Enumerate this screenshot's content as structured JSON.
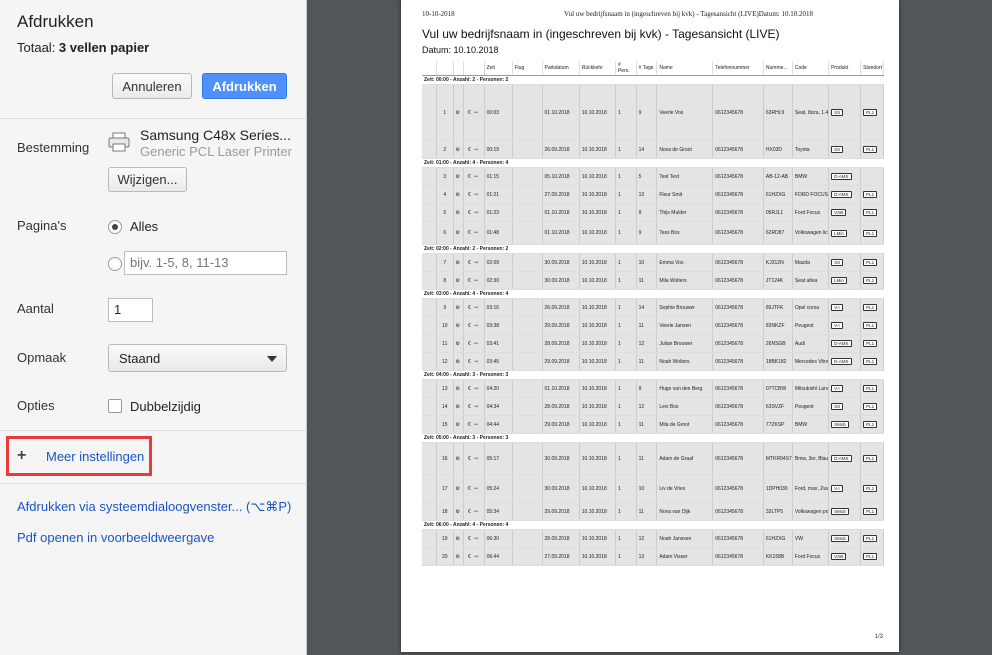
{
  "dialog": {
    "title": "Afdrukken",
    "total_prefix": "Totaal: ",
    "total_value": "3 vellen papier",
    "cancel_label": "Annuleren",
    "print_label": "Afdrukken",
    "destination_label": "Bestemming",
    "printer_name": "Samsung C48x Series...",
    "printer_driver": "Generic PCL Laser Printer",
    "change_label": "Wijzigen...",
    "pages_label": "Pagina's",
    "pages_all": "Alles",
    "pages_range_placeholder": "bijv. 1-5, 8, 11-13",
    "copies_label": "Aantal",
    "copies_value": "1",
    "layout_label": "Opmaak",
    "layout_value": "Staand",
    "options_label": "Opties",
    "duplex_label": "Dubbelzijdig",
    "more_settings": "Meer instellingen",
    "system_dialog_link": "Afdrukken via systeemdialoogvenster... (⌥⌘P)",
    "open_pdf_link": "Pdf openen in voorbeeldweergave"
  },
  "preview": {
    "header_date": "10-10-2018",
    "header_title": "Vul uw bedrijfsnaam in (ingeschreven bij kvk) - Tagesansicht (LIVE)Datum: 10.10.2018",
    "title": "Vul uw bedrijfsnaam in (ingeschreven bij kvk) - Tagesansicht (LIVE)",
    "date_line": "Datum: 10.10.2018",
    "page_number": "1/3",
    "columns": [
      "",
      "",
      "",
      "",
      "Zeit",
      "Flug",
      "Parkdatum",
      "Rückkehr",
      "# Pers.",
      "# Tage",
      "Name",
      "Telefonnummer",
      "Numme...",
      "Code",
      "Produkt",
      "Standort"
    ],
    "groups": [
      {
        "label": "Zeit: 00:00 - Anzahl: 2 - Personen: 2",
        "rows": [
          {
            "n": "1",
            "time": "00:03",
            "park": "01.10.2018",
            "ret": "10.10.2018",
            "pers": "1",
            "days": "9",
            "name": "Veerle Vos",
            "phone": "0612345678",
            "num": "63RHL9",
            "code": "Seat, Ibiza, 1.4 16V, Zwart",
            "prod": "SS",
            "loc": "PL1"
          },
          {
            "n": "2",
            "time": "00:19",
            "park": "26.09.2018",
            "ret": "10.10.2018",
            "pers": "1",
            "days": "14",
            "name": "Nova de Groot",
            "phone": "0612345678",
            "num": "HX03D",
            "code": "Toyota",
            "prod": "SS",
            "loc": "PL1"
          }
        ]
      },
      {
        "label": "Zeit: 01:00 - Anzahl: 4 - Personen: 4",
        "rows": [
          {
            "n": "3",
            "time": "01:15",
            "park": "05.10.2018",
            "ret": "10.10.2018",
            "pers": "1",
            "days": "5",
            "name": "Test Test",
            "phone": "0612345678",
            "num": "AB-12-AB",
            "code": "BMW",
            "prod": "D-AMS",
            "loc": ""
          },
          {
            "n": "4",
            "time": "01:21",
            "park": "27.09.2018",
            "ret": "10.10.2018",
            "pers": "1",
            "days": "13",
            "name": "Fleur Smit",
            "phone": "0612345678",
            "num": "61HZXG",
            "code": "FORD FOCUS",
            "prod": "D-AMS",
            "loc": "PL1"
          },
          {
            "n": "5",
            "time": "01:23",
            "park": "01.10.2018",
            "ret": "10.10.2018",
            "pers": "1",
            "days": "9",
            "name": "Thijs Mulder",
            "phone": "0612345678",
            "num": "05RJL1",
            "code": "Ford Focus",
            "prod": "VSB",
            "loc": "PL1"
          },
          {
            "n": "6",
            "time": "01:48",
            "park": "01.10.2018",
            "ret": "10.10.2018",
            "pers": "1",
            "days": "9",
            "name": "Tess Bos",
            "phone": "0612345678",
            "num": "62RD87",
            "code": "Volkswagen lichtblauw",
            "prod": "LMin",
            "loc": "PL1"
          }
        ]
      },
      {
        "label": "Zeit: 02:00 - Anzahl: 2 - Personen: 2",
        "rows": [
          {
            "n": "7",
            "time": "02:09",
            "park": "30.09.2018",
            "ret": "10.10.2018",
            "pers": "1",
            "days": "10",
            "name": "Emma Vos",
            "phone": "0612345678",
            "num": "KJ312N",
            "code": "Mazda",
            "prod": "SS",
            "loc": "PL1"
          },
          {
            "n": "8",
            "time": "02:30",
            "park": "30.09.2018",
            "ret": "10.10.2018",
            "pers": "1",
            "days": "11",
            "name": "Mila Wolters",
            "phone": "0612345678",
            "num": "JT124K",
            "code": "Seat altea",
            "prod": "LMin",
            "loc": "PL1"
          }
        ]
      },
      {
        "label": "Zeit: 03:00 - Anzahl: 4 - Personen: 4",
        "rows": [
          {
            "n": "9",
            "time": "03:16",
            "park": "26.09.2018",
            "ret": "10.10.2018",
            "pers": "1",
            "days": "14",
            "name": "Sophie Brouwer",
            "phone": "0612345678",
            "num": "89JTFK",
            "code": "Opel corsa",
            "prod": "V-I",
            "loc": "PL1"
          },
          {
            "n": "10",
            "time": "03:38",
            "park": "29.09.2018",
            "ret": "10.10.2018",
            "pers": "1",
            "days": "11",
            "name": "Veerle Jansen",
            "phone": "0612345678",
            "num": "83NKZF",
            "code": "Peugeot",
            "prod": "V-I",
            "loc": "PL1"
          },
          {
            "n": "11",
            "time": "03:41",
            "park": "28.09.2018",
            "ret": "10.10.2018",
            "pers": "1",
            "days": "12",
            "name": "Julian Brouwer",
            "phone": "0612345678",
            "num": "26NSGB",
            "code": "Audi",
            "prod": "D-AMS",
            "loc": "PL1"
          },
          {
            "n": "12",
            "time": "03:45",
            "park": "29.09.2018",
            "ret": "10.10.2018",
            "pers": "1",
            "days": "11",
            "name": "Noah Wolters",
            "phone": "0612345678",
            "num": "18BK182",
            "code": "Mercedes Vitro",
            "prod": "D-AMS",
            "loc": "PL1"
          }
        ]
      },
      {
        "label": "Zeit: 04:00 - Anzahl: 3 - Personen: 3",
        "rows": [
          {
            "n": "13",
            "time": "04:20",
            "park": "01.10.2018",
            "ret": "10.10.2018",
            "pers": "1",
            "days": "9",
            "name": "Hugo van den Berg",
            "phone": "0612345678",
            "num": "07TCBW",
            "code": "Mitsubishi Lancer",
            "prod": "V-I",
            "loc": "PL1"
          },
          {
            "n": "14",
            "time": "04:34",
            "park": "28.09.2018",
            "ret": "10.10.2018",
            "pers": "1",
            "days": "12",
            "name": "Levi Bos",
            "phone": "0612345678",
            "num": "63SVZF",
            "code": "Peugeot",
            "prod": "SS",
            "loc": "PL1"
          },
          {
            "n": "15",
            "time": "04:44",
            "park": "29.09.2018",
            "ret": "10.10.2018",
            "pers": "1",
            "days": "11",
            "name": "Mila de Groot",
            "phone": "0612345678",
            "num": "77ZKSP",
            "code": "BMW",
            "prod": "SMob",
            "loc": "PL1"
          }
        ]
      },
      {
        "label": "Zeit: 05:00 - Anzahl: 3 - Personen: 3",
        "rows": [
          {
            "n": "16",
            "time": "05:17",
            "park": "30.09.2018",
            "ret": "10.10.2018",
            "pers": "1",
            "days": "11",
            "name": "Adam de Graaf",
            "phone": "0612345678",
            "num": "MTKR94S7",
            "code": "Bmw, 3er, Blauw",
            "prod": "D-AMS",
            "loc": "PL1"
          },
          {
            "n": "17",
            "time": "05:24",
            "park": "30.09.2018",
            "ret": "10.10.2018",
            "pers": "1",
            "days": "10",
            "name": "Liv de Vries",
            "phone": "0612345678",
            "num": "1DPH030",
            "code": "Ford, max, Zwart",
            "prod": "V-I",
            "loc": "PL1"
          },
          {
            "n": "18",
            "time": "05:34",
            "park": "29.09.2018",
            "ret": "10.10.2018",
            "pers": "1",
            "days": "11",
            "name": "Nova van Dijk",
            "phone": "0612345678",
            "num": "33LTP5",
            "code": "Volkswagen polo",
            "prod": "SMob",
            "loc": "PL1"
          }
        ]
      },
      {
        "label": "Zeit: 06:00 - Anzahl: 4 - Personen: 4",
        "rows": [
          {
            "n": "19",
            "time": "06:30",
            "park": "28.09.2018",
            "ret": "10.10.2018",
            "pers": "1",
            "days": "12",
            "name": "Noah Janssen",
            "phone": "0612345678",
            "num": "61HZXG",
            "code": "VW",
            "prod": "SMob",
            "loc": "PL1"
          },
          {
            "n": "20",
            "time": "06:44",
            "park": "27.09.2018",
            "ret": "10.10.2018",
            "pers": "1",
            "days": "13",
            "name": "Adam Visser",
            "phone": "0612345678",
            "num": "KK158B",
            "code": "Ford Focus",
            "prod": "VSB",
            "loc": "PL1"
          }
        ]
      }
    ]
  }
}
